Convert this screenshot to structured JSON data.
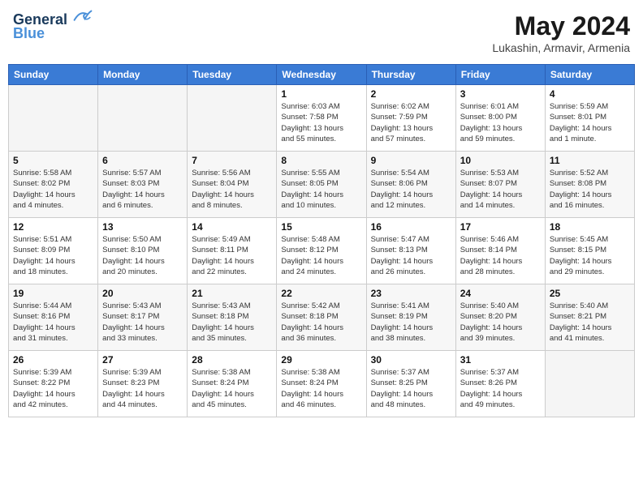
{
  "header": {
    "logo_line1": "General",
    "logo_line2": "Blue",
    "title": "May 2024",
    "subtitle": "Lukashin, Armavir, Armenia"
  },
  "weekdays": [
    "Sunday",
    "Monday",
    "Tuesday",
    "Wednesday",
    "Thursday",
    "Friday",
    "Saturday"
  ],
  "weeks": [
    [
      {
        "day": "",
        "info": ""
      },
      {
        "day": "",
        "info": ""
      },
      {
        "day": "",
        "info": ""
      },
      {
        "day": "1",
        "info": "Sunrise: 6:03 AM\nSunset: 7:58 PM\nDaylight: 13 hours\nand 55 minutes."
      },
      {
        "day": "2",
        "info": "Sunrise: 6:02 AM\nSunset: 7:59 PM\nDaylight: 13 hours\nand 57 minutes."
      },
      {
        "day": "3",
        "info": "Sunrise: 6:01 AM\nSunset: 8:00 PM\nDaylight: 13 hours\nand 59 minutes."
      },
      {
        "day": "4",
        "info": "Sunrise: 5:59 AM\nSunset: 8:01 PM\nDaylight: 14 hours\nand 1 minute."
      }
    ],
    [
      {
        "day": "5",
        "info": "Sunrise: 5:58 AM\nSunset: 8:02 PM\nDaylight: 14 hours\nand 4 minutes."
      },
      {
        "day": "6",
        "info": "Sunrise: 5:57 AM\nSunset: 8:03 PM\nDaylight: 14 hours\nand 6 minutes."
      },
      {
        "day": "7",
        "info": "Sunrise: 5:56 AM\nSunset: 8:04 PM\nDaylight: 14 hours\nand 8 minutes."
      },
      {
        "day": "8",
        "info": "Sunrise: 5:55 AM\nSunset: 8:05 PM\nDaylight: 14 hours\nand 10 minutes."
      },
      {
        "day": "9",
        "info": "Sunrise: 5:54 AM\nSunset: 8:06 PM\nDaylight: 14 hours\nand 12 minutes."
      },
      {
        "day": "10",
        "info": "Sunrise: 5:53 AM\nSunset: 8:07 PM\nDaylight: 14 hours\nand 14 minutes."
      },
      {
        "day": "11",
        "info": "Sunrise: 5:52 AM\nSunset: 8:08 PM\nDaylight: 14 hours\nand 16 minutes."
      }
    ],
    [
      {
        "day": "12",
        "info": "Sunrise: 5:51 AM\nSunset: 8:09 PM\nDaylight: 14 hours\nand 18 minutes."
      },
      {
        "day": "13",
        "info": "Sunrise: 5:50 AM\nSunset: 8:10 PM\nDaylight: 14 hours\nand 20 minutes."
      },
      {
        "day": "14",
        "info": "Sunrise: 5:49 AM\nSunset: 8:11 PM\nDaylight: 14 hours\nand 22 minutes."
      },
      {
        "day": "15",
        "info": "Sunrise: 5:48 AM\nSunset: 8:12 PM\nDaylight: 14 hours\nand 24 minutes."
      },
      {
        "day": "16",
        "info": "Sunrise: 5:47 AM\nSunset: 8:13 PM\nDaylight: 14 hours\nand 26 minutes."
      },
      {
        "day": "17",
        "info": "Sunrise: 5:46 AM\nSunset: 8:14 PM\nDaylight: 14 hours\nand 28 minutes."
      },
      {
        "day": "18",
        "info": "Sunrise: 5:45 AM\nSunset: 8:15 PM\nDaylight: 14 hours\nand 29 minutes."
      }
    ],
    [
      {
        "day": "19",
        "info": "Sunrise: 5:44 AM\nSunset: 8:16 PM\nDaylight: 14 hours\nand 31 minutes."
      },
      {
        "day": "20",
        "info": "Sunrise: 5:43 AM\nSunset: 8:17 PM\nDaylight: 14 hours\nand 33 minutes."
      },
      {
        "day": "21",
        "info": "Sunrise: 5:43 AM\nSunset: 8:18 PM\nDaylight: 14 hours\nand 35 minutes."
      },
      {
        "day": "22",
        "info": "Sunrise: 5:42 AM\nSunset: 8:18 PM\nDaylight: 14 hours\nand 36 minutes."
      },
      {
        "day": "23",
        "info": "Sunrise: 5:41 AM\nSunset: 8:19 PM\nDaylight: 14 hours\nand 38 minutes."
      },
      {
        "day": "24",
        "info": "Sunrise: 5:40 AM\nSunset: 8:20 PM\nDaylight: 14 hours\nand 39 minutes."
      },
      {
        "day": "25",
        "info": "Sunrise: 5:40 AM\nSunset: 8:21 PM\nDaylight: 14 hours\nand 41 minutes."
      }
    ],
    [
      {
        "day": "26",
        "info": "Sunrise: 5:39 AM\nSunset: 8:22 PM\nDaylight: 14 hours\nand 42 minutes."
      },
      {
        "day": "27",
        "info": "Sunrise: 5:39 AM\nSunset: 8:23 PM\nDaylight: 14 hours\nand 44 minutes."
      },
      {
        "day": "28",
        "info": "Sunrise: 5:38 AM\nSunset: 8:24 PM\nDaylight: 14 hours\nand 45 minutes."
      },
      {
        "day": "29",
        "info": "Sunrise: 5:38 AM\nSunset: 8:24 PM\nDaylight: 14 hours\nand 46 minutes."
      },
      {
        "day": "30",
        "info": "Sunrise: 5:37 AM\nSunset: 8:25 PM\nDaylight: 14 hours\nand 48 minutes."
      },
      {
        "day": "31",
        "info": "Sunrise: 5:37 AM\nSunset: 8:26 PM\nDaylight: 14 hours\nand 49 minutes."
      },
      {
        "day": "",
        "info": ""
      }
    ]
  ]
}
